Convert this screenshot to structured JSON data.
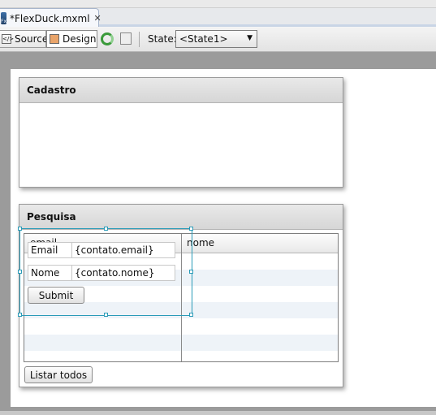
{
  "editor_tab": {
    "title": "*FlexDuck.mxml",
    "close_icon": "close-icon"
  },
  "toolbar": {
    "source_label": "Source",
    "design_label": "Design",
    "state_label": "State:",
    "state_value": "<State1>"
  },
  "panels": {
    "cadastro": {
      "title": "Cadastro"
    },
    "pesquisa": {
      "title": "Pesquisa",
      "grid": {
        "columns": [
          "email",
          "nome"
        ]
      },
      "form": {
        "email_label": "Email",
        "email_value": "{contato.email}",
        "nome_label": "Nome",
        "nome_value": "{contato.nome}",
        "submit_label": "Submit"
      },
      "list_all_label": "Listar todos"
    }
  },
  "colors": {
    "selection": "#2a9bb8",
    "grid_alt_row": "#eef3f8",
    "background": "#9b9b9b"
  }
}
